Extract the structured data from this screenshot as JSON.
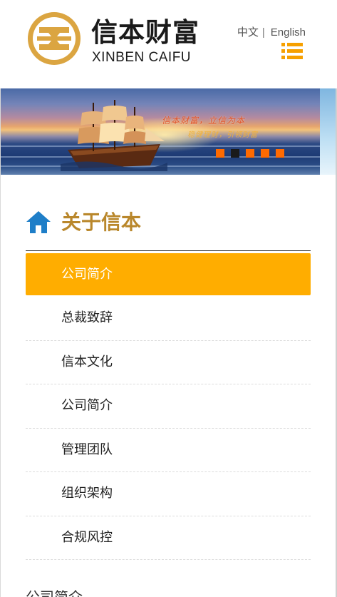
{
  "header": {
    "logo_cn": "信本财富",
    "logo_en": "XINBEN CAIFU",
    "lang_cn": "中文",
    "lang_sep": "|",
    "lang_en": "English",
    "menu_icon": "list-menu-icon",
    "accent": "#f6a000",
    "logo_color": "#dba541"
  },
  "banner": {
    "slogan": "信本财富，立信为本",
    "slogan2": "稳健理财，引领财富",
    "slides": 5,
    "active_slide": 2,
    "dot_color": "#ff6a00",
    "dot_active_color": "#1a1a1a"
  },
  "section": {
    "icon": "home-icon",
    "title": "关于信本",
    "title_color": "#b9872b",
    "icon_color": "#1e7ec8"
  },
  "nav": {
    "active_color": "#ffad00",
    "items": [
      {
        "label": "公司简介",
        "active": true
      },
      {
        "label": "总裁致辞",
        "active": false
      },
      {
        "label": "信本文化",
        "active": false
      },
      {
        "label": "公司简介",
        "active": false
      },
      {
        "label": "管理团队",
        "active": false
      },
      {
        "label": "组织架构",
        "active": false
      },
      {
        "label": "合规风控",
        "active": false
      }
    ]
  },
  "content": {
    "heading_peek": "公司简介"
  }
}
